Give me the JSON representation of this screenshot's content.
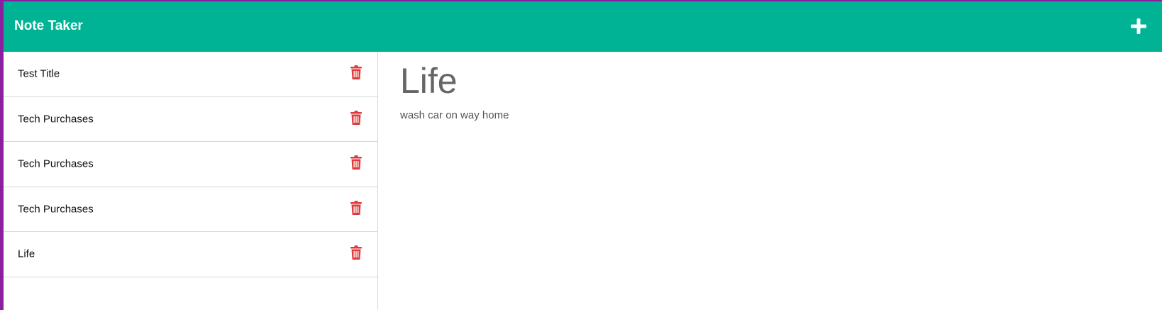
{
  "app": {
    "title": "Note Taker",
    "add_icon": "plus-icon",
    "colors": {
      "navbar": "#00b395",
      "accent_border": "#8a1fa0",
      "trash": "#e03b3b"
    }
  },
  "sidebar": {
    "items": [
      {
        "title": "Test Title",
        "icon": "trash-icon"
      },
      {
        "title": "Tech Purchases",
        "icon": "trash-icon"
      },
      {
        "title": "Tech Purchases",
        "icon": "trash-icon"
      },
      {
        "title": "Tech Purchases",
        "icon": "trash-icon"
      },
      {
        "title": "Life",
        "icon": "trash-icon"
      }
    ]
  },
  "main": {
    "title": "Life",
    "body": "wash car on way home"
  }
}
